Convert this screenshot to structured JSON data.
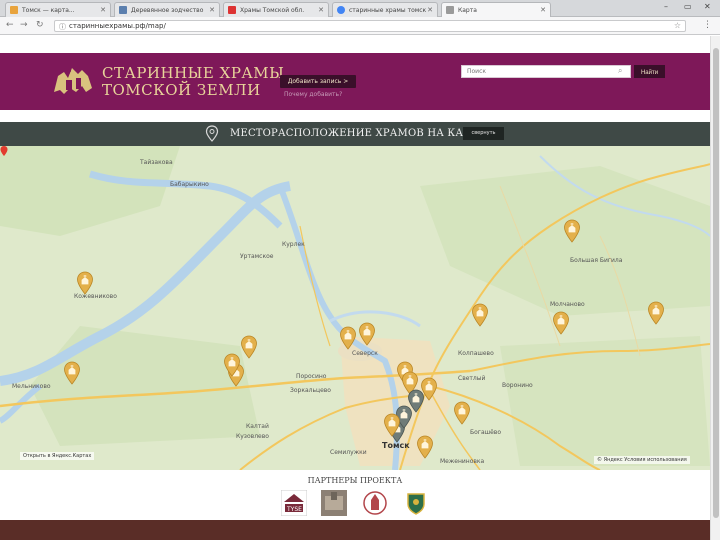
{
  "browser": {
    "tabs": [
      {
        "label": "Томск — карта...",
        "active": false,
        "favicon_color": "#e8a33c"
      },
      {
        "label": "Деревянное зодчество",
        "active": false,
        "favicon_color": "#5b7fae"
      },
      {
        "label": "Храмы Томской обл.",
        "active": false,
        "favicon_color": "#d33"
      },
      {
        "label": "старинные храмы томск",
        "active": false,
        "favicon_color": "#4285f4"
      },
      {
        "label": "Карта",
        "active": true,
        "favicon_color": "#9a9a9a"
      }
    ],
    "url": "старинныехрамы.рф/map/",
    "window_controls": [
      "–",
      "▭",
      "✕"
    ]
  },
  "header": {
    "logo_line1": "СТАРИННЫЕ ХРАМЫ",
    "logo_line2": "ТОМСКОЙ ЗЕМЛИ",
    "add_entry_label": "Добавить запись >",
    "how_add_label": "Почему добавить?",
    "search_placeholder": "Поиск",
    "search_button": "Найти"
  },
  "map_bar": {
    "title": "МЕСТОРАСПОЛОЖЕНИЕ ХРАМОВ НА КАРТЕ",
    "collapse_label": "свернуть"
  },
  "map": {
    "places": [
      {
        "name": "Мельниково"
      },
      {
        "name": "Кожевниково"
      },
      {
        "name": "Тайзакова"
      },
      {
        "name": "Уртамское"
      },
      {
        "name": "Курлек"
      },
      {
        "name": "Северск"
      },
      {
        "name": "Томск"
      },
      {
        "name": "Колпашево"
      },
      {
        "name": "Зоркальцево"
      },
      {
        "name": "Светлый"
      },
      {
        "name": "Воронино"
      },
      {
        "name": "Богашёво"
      },
      {
        "name": "Молчаново"
      },
      {
        "name": "Большая Бигила"
      },
      {
        "name": "Бабарыкино"
      },
      {
        "name": "Калтай"
      },
      {
        "name": "Кузовлево"
      },
      {
        "name": "Поросино"
      },
      {
        "name": "Семилужки"
      },
      {
        "name": "Межениновка"
      }
    ],
    "attribution": "Открыть в Яндекс.Картах",
    "terms": "© Яндекс  Условия использования",
    "marker_color": "#e3b04b",
    "active_marker_color": "#6f7c78"
  },
  "partners": {
    "title": "ПАРТНЕРЫ ПРОЕКТА",
    "items": [
      {
        "name": "TYSE"
      },
      {
        "name": "photo"
      },
      {
        "name": "tower"
      },
      {
        "name": "crest"
      }
    ]
  },
  "colors": {
    "header_bg": "#7e1859",
    "header_text": "#e8d49a",
    "map_bar_bg": "#3f4946"
  }
}
